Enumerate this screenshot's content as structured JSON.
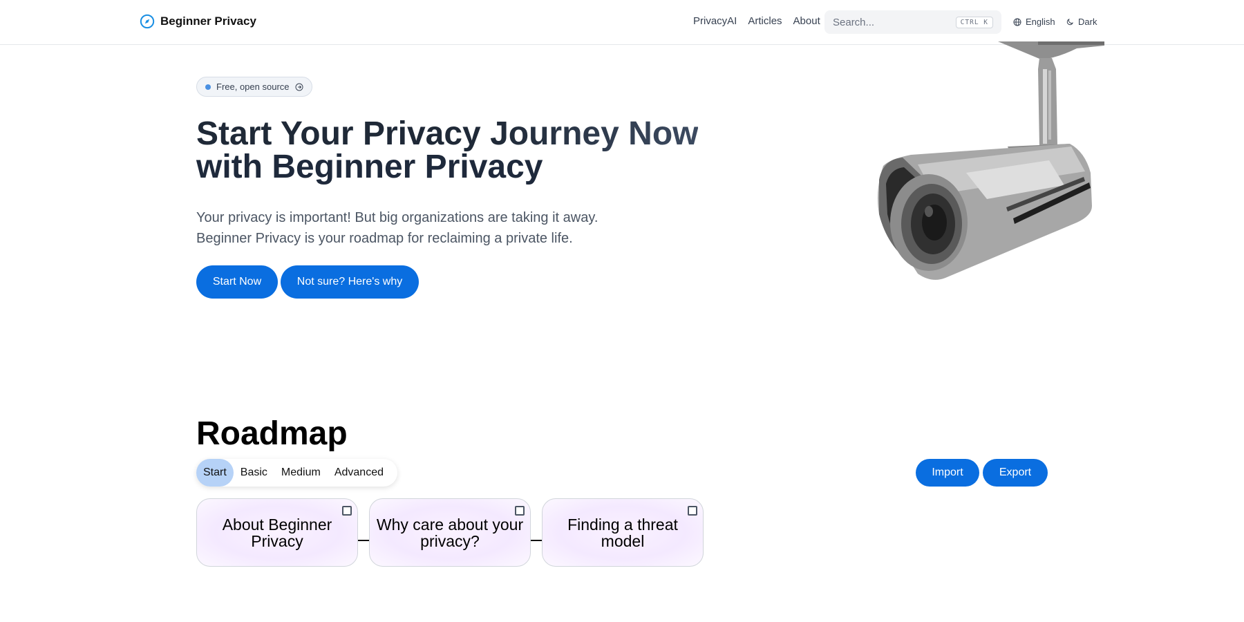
{
  "header": {
    "brand": "Beginner Privacy",
    "nav": [
      "PrivacyAI",
      "Articles",
      "About"
    ],
    "search_placeholder": "Search...",
    "search_kbd": "CTRL K",
    "language": "English",
    "theme": "Dark"
  },
  "hero": {
    "badge": "Free, open source",
    "title_line1_a": "Start Your Privacy ",
    "title_line1_b": "Journey Now",
    "title_line2": "with Beginner Privacy",
    "subtitle_line1": "Your privacy is important! But big organizations are taking it away.",
    "subtitle_line2": "Beginner Privacy is your roadmap for reclaiming a private life.",
    "btn_start": "Start Now",
    "btn_why": "Not sure? Here's why"
  },
  "roadmap": {
    "title": "Roadmap",
    "tabs": [
      "Start",
      "Basic",
      "Medium",
      "Advanced"
    ],
    "active_tab": "Start",
    "import_label": "Import",
    "export_label": "Export",
    "cards": [
      "About Beginner Privacy",
      "Why care about your privacy?",
      "Finding a threat model"
    ]
  },
  "colors": {
    "accent": "#0a6ee0",
    "active_tab": "#b6d2f7"
  }
}
